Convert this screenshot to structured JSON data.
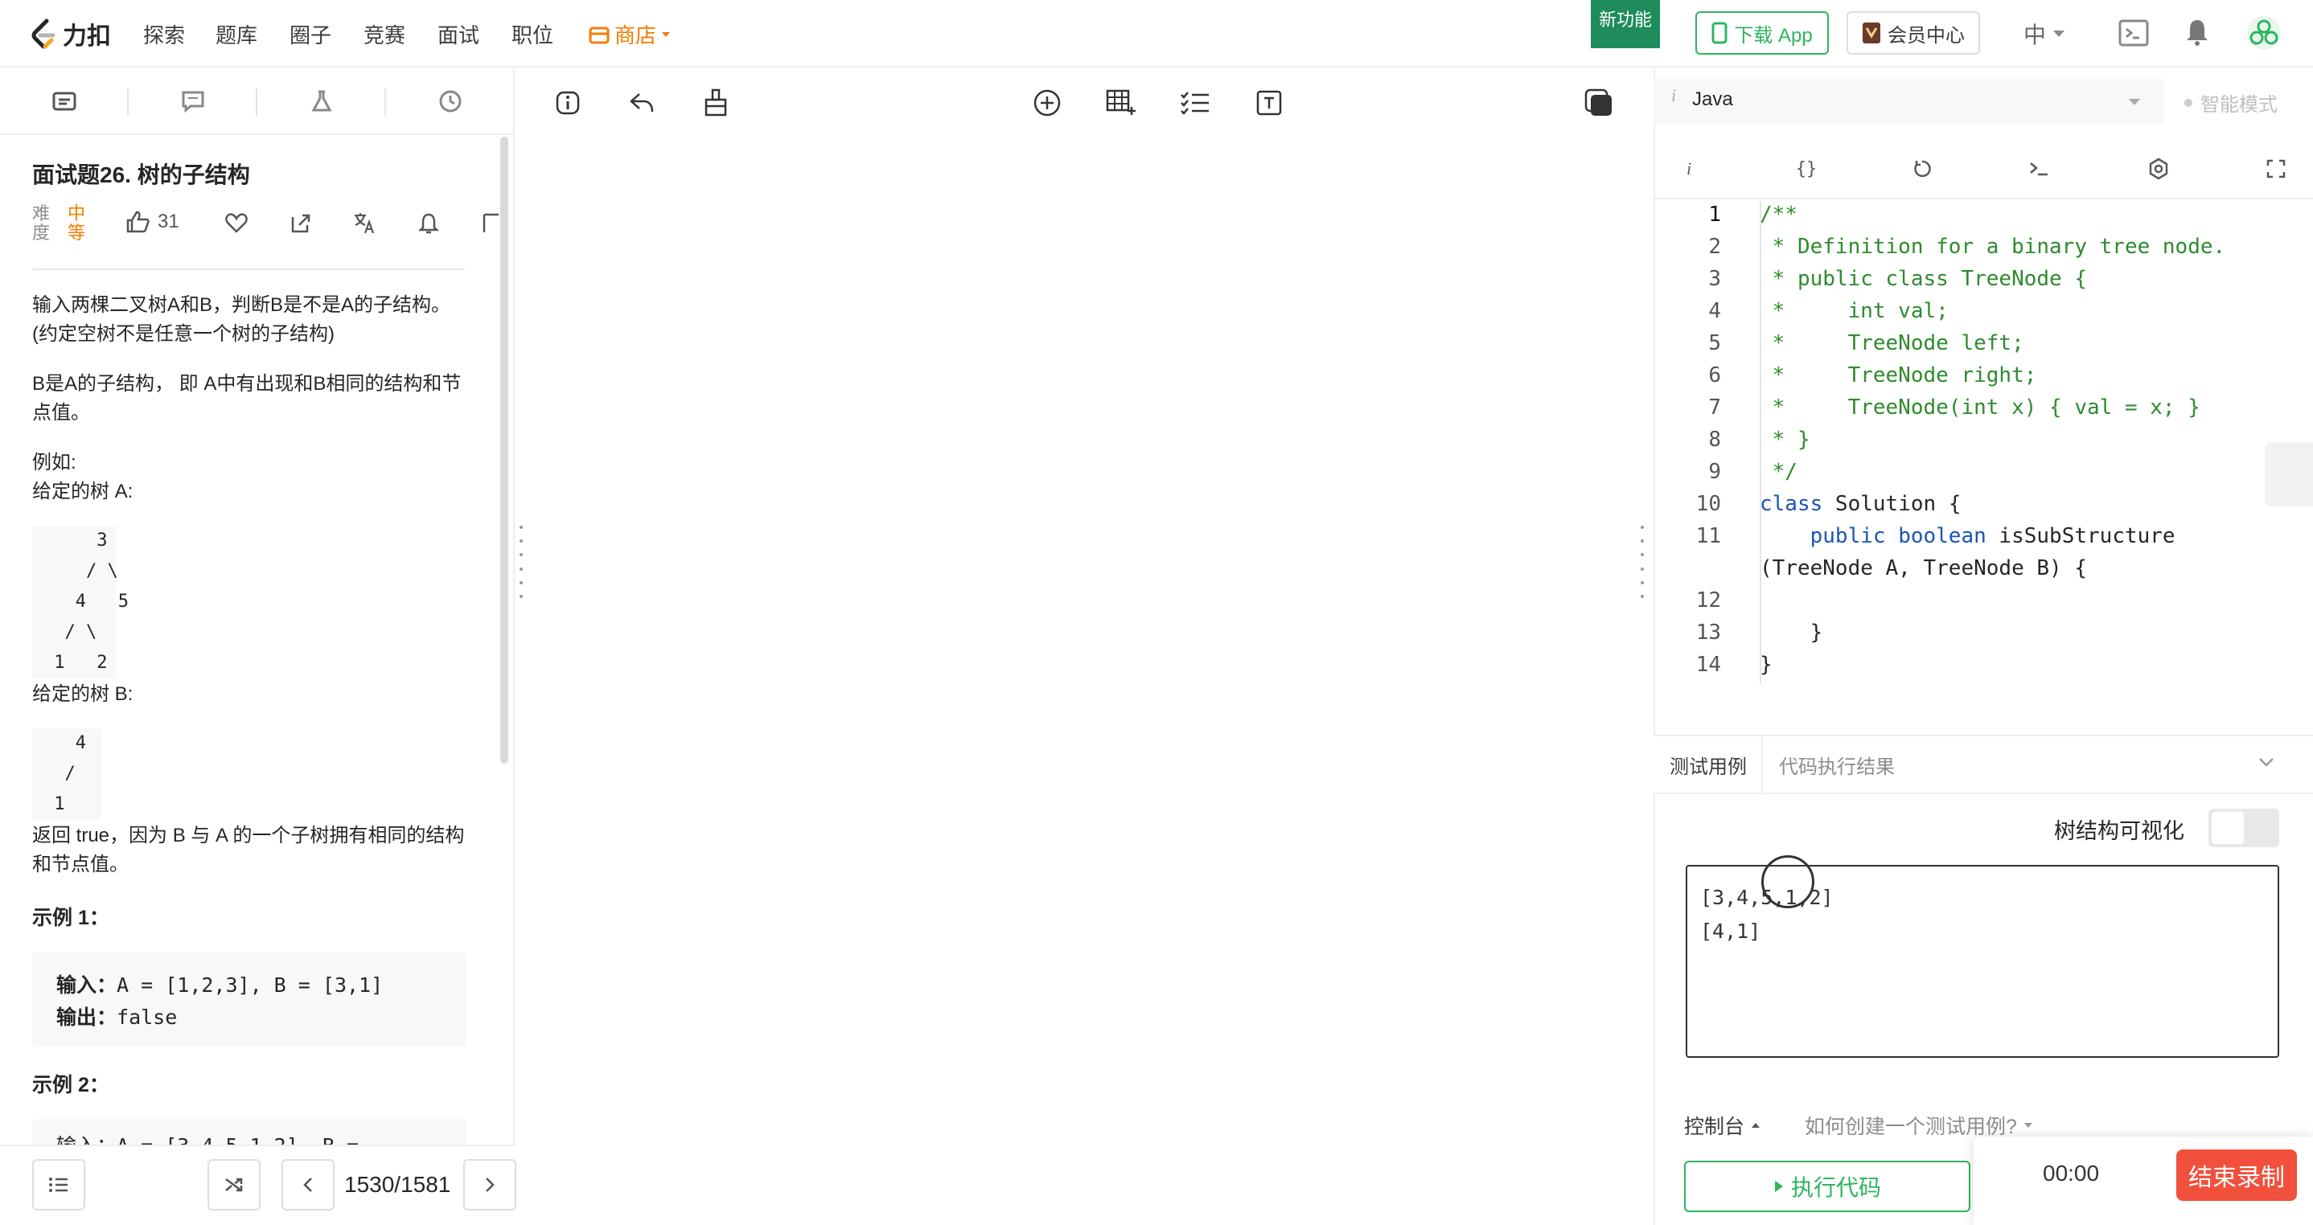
{
  "brand": {
    "logo_text": "力扣"
  },
  "nav": {
    "items": [
      "探索",
      "题库",
      "圈子",
      "竞赛",
      "面试",
      "职位"
    ],
    "shop": "商店",
    "new_feature": "新功能",
    "download_app": "下载 App",
    "vip": "会员中心",
    "lang": "中"
  },
  "problem": {
    "title": "面试题26. 树的子结构",
    "difficulty_label": [
      "难",
      "度"
    ],
    "difficulty_value": [
      "中",
      "等"
    ],
    "likes": "31",
    "desc1": "输入两棵二叉树A和B，判断B是不是A的子结构。(约定空树不是任意一个树的子结构)",
    "desc2": "B是A的子结构， 即 A中有出现和B相同的结构和节点值。",
    "example_intro": "例如:",
    "tree_a_label": "给定的树 A:",
    "tree_a": [
      "     3",
      "    / \\",
      "   4   5",
      "  / \\",
      " 1   2"
    ],
    "tree_b_label": "给定的树 B:",
    "tree_b": [
      "   4 ",
      "  /",
      " 1"
    ],
    "return_text": "返回 true，因为 B 与 A 的一个子树拥有相同的结构和节点值。",
    "example1_title": "示例 1：",
    "example1_input_label": "输入：",
    "example1_input": "A = [1,2,3], B = [3,1]",
    "example1_output_label": "输出：",
    "example1_output": "false",
    "example2_title": "示例 2：",
    "example2_partial": "输入：A = [3,4,5,1,2], B = ..."
  },
  "footer": {
    "page": "1530/1581"
  },
  "editor": {
    "language": "Java",
    "smart_mode": "智能模式",
    "line_numbers": [
      "1",
      "2",
      "3",
      "4",
      "5",
      "6",
      "7",
      "8",
      "9",
      "10",
      "11",
      "",
      "12",
      "13",
      "14"
    ],
    "lines": [
      "/**",
      " * Definition for a binary tree node.",
      " * public class TreeNode {",
      " *     int val;",
      " *     TreeNode left;",
      " *     TreeNode right;",
      " *     TreeNode(int x) { val = x; }",
      " * }",
      " */",
      "class Solution {",
      "    public boolean isSubStructure",
      "(TreeNode A, TreeNode B) {",
      "",
      "    }",
      "}"
    ]
  },
  "testpanel": {
    "tab_testcase": "测试用例",
    "tab_result": "代码执行结果",
    "tree_visualize": "树结构可视化",
    "input_line1": "[3,4,5,1,2]",
    "input_line2": "[4,1]",
    "console": "控制台",
    "howto": "如何创建一个测试用例?",
    "run": "执行代码"
  },
  "recording": {
    "time": "00:00",
    "stop": "结束录制"
  },
  "colors": {
    "accent": "#2db55d",
    "orange": "#f57c00",
    "comment": "#2e8b2e",
    "keyword": "#1a56b3",
    "stop": "#f0503c"
  }
}
